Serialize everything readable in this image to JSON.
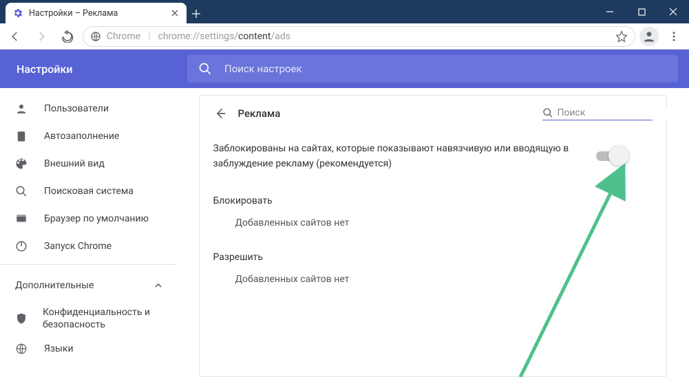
{
  "window": {
    "tab_title": "Настройки – Реклама"
  },
  "toolbar": {
    "url_prefix": "Chrome",
    "url_scheme": "chrome://",
    "url_grey1": "settings/",
    "url_dark": "content",
    "url_grey2": "/ads"
  },
  "blue_header": {
    "brand": "Настройки",
    "search_placeholder": "Поиск настроек"
  },
  "sidebar": {
    "items": [
      {
        "label": "Пользователи"
      },
      {
        "label": "Автозаполнение"
      },
      {
        "label": "Внешний вид"
      },
      {
        "label": "Поисковая система"
      },
      {
        "label": "Браузер по умолчанию"
      },
      {
        "label": "Запуск Chrome"
      }
    ],
    "advanced_label": "Дополнительные",
    "sub": [
      {
        "label": "Конфиденциальность и безопасность"
      },
      {
        "label": "Языки"
      }
    ]
  },
  "main": {
    "page_title": "Реклама",
    "search_placeholder": "Поиск",
    "toggle_label": "Заблокированы на сайтах, которые показывают навязчивую или вводящую в заблуждение рекламу (рекомендуется)",
    "block_section": "Блокировать",
    "block_empty": "Добавленных сайтов нет",
    "allow_section": "Разрешить",
    "allow_empty": "Добавленных сайтов нет"
  }
}
